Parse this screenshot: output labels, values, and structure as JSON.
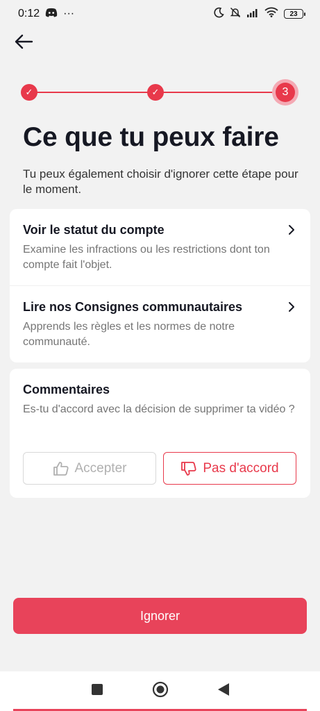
{
  "status_bar": {
    "time": "0:12",
    "more": "···",
    "battery": "23"
  },
  "stepper": {
    "current_step": "3",
    "completed_mark": "✓"
  },
  "page": {
    "title": "Ce que tu peux faire",
    "subtitle": "Tu peux également choisir d'ignorer cette étape pour le moment."
  },
  "links": [
    {
      "title": "Voir le statut du compte",
      "description": "Examine les infractions ou les restrictions dont ton compte fait l'objet."
    },
    {
      "title": "Lire nos Consignes communautaires",
      "description": "Apprends les règles et les normes de notre communauté."
    }
  ],
  "feedback": {
    "title": "Commentaires",
    "question": "Es-tu d'accord avec la décision de supprimer ta vidéo ?",
    "accept_label": "Accepter",
    "disagree_label": "Pas d'accord"
  },
  "footer": {
    "ignore_label": "Ignorer"
  },
  "colors": {
    "accent": "#e8394b",
    "background": "#f2f2f2"
  }
}
